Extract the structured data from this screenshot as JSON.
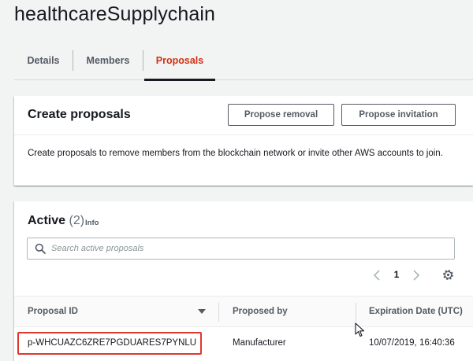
{
  "page": {
    "title": "healthcareSupplychain"
  },
  "tabs": [
    {
      "label": "Details",
      "active": false
    },
    {
      "label": "Members",
      "active": false
    },
    {
      "label": "Proposals",
      "active": true
    }
  ],
  "create_panel": {
    "title": "Create proposals",
    "propose_removal_label": "Propose removal",
    "propose_invitation_label": "Propose invitation",
    "description": "Create proposals to remove members from the blockchain network or invite other AWS accounts to join."
  },
  "active_panel": {
    "title": "Active",
    "count": "(2)",
    "info_label": "Info",
    "search_placeholder": "Search active proposals",
    "current_page": "1",
    "columns": [
      "Proposal ID",
      "Proposed by",
      "Expiration Date (UTC)"
    ],
    "rows": [
      {
        "proposal_id": "p-WHCUAZC6ZRE7PGDUARES7PYNLU",
        "proposed_by": "Manufacturer",
        "expiration": "10/07/2019, 16:40:36"
      }
    ]
  },
  "colors": {
    "active_tab": "#d13212",
    "highlight_border": "#e0372b",
    "background": "#f2f3f3"
  },
  "icons": [
    "search-icon",
    "chevron-left-icon",
    "chevron-right-icon",
    "gear-icon",
    "sort-down-icon",
    "mouse-cursor-icon"
  ]
}
